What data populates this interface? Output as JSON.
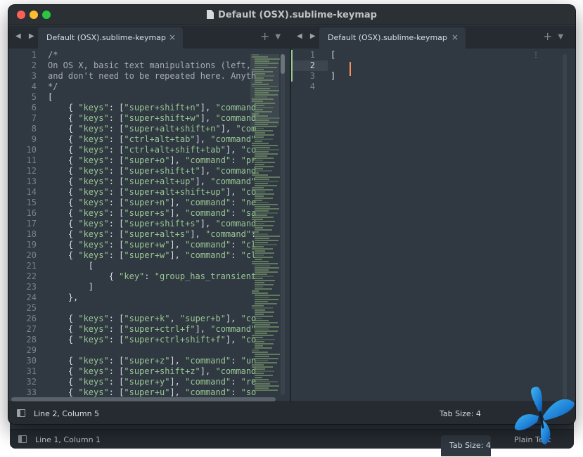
{
  "window": {
    "title": "Default (OSX).sublime-keymap"
  },
  "tabs": {
    "left_label": "Default (OSX).sublime-keymap",
    "right_label": "Default (OSX).sublime-keymap",
    "close_glyph": "×",
    "add_glyph": "+",
    "menu_glyph": "▼",
    "nav_glyph": "◀ ▶"
  },
  "left_pane": {
    "line_numbers": [
      "1",
      "2",
      "3",
      "4",
      "5",
      "6",
      "7",
      "8",
      "9",
      "10",
      "11",
      "12",
      "13",
      "14",
      "15",
      "16",
      "17",
      "18",
      "19",
      "20",
      "21",
      "22",
      "23",
      "24",
      "25",
      "26",
      "27",
      "28",
      "29",
      "30",
      "31",
      "32",
      "33"
    ],
    "lines": [
      [
        {
          "c": "c-com",
          "t": "/*"
        }
      ],
      [
        {
          "c": "c-com",
          "t": "On OS X, basic text manipulations (left,"
        }
      ],
      [
        {
          "c": "c-com",
          "t": "and don't need to be repeated here. Anyth"
        }
      ],
      [
        {
          "c": "c-com",
          "t": "*/"
        }
      ],
      [
        {
          "c": "c-txt",
          "t": "["
        }
      ],
      [
        {
          "c": "c-txt",
          "t": "    { "
        },
        {
          "c": "c-str",
          "t": "\"keys\""
        },
        {
          "c": "c-txt",
          "t": ": ["
        },
        {
          "c": "c-str",
          "t": "\"super+shift+n\""
        },
        {
          "c": "c-txt",
          "t": "], "
        },
        {
          "c": "c-str",
          "t": "\"command"
        }
      ],
      [
        {
          "c": "c-txt",
          "t": "    { "
        },
        {
          "c": "c-str",
          "t": "\"keys\""
        },
        {
          "c": "c-txt",
          "t": ": ["
        },
        {
          "c": "c-str",
          "t": "\"super+shift+w\""
        },
        {
          "c": "c-txt",
          "t": "], "
        },
        {
          "c": "c-str",
          "t": "\"command"
        }
      ],
      [
        {
          "c": "c-txt",
          "t": "    { "
        },
        {
          "c": "c-str",
          "t": "\"keys\""
        },
        {
          "c": "c-txt",
          "t": ": ["
        },
        {
          "c": "c-str",
          "t": "\"super+alt+shift+n\""
        },
        {
          "c": "c-txt",
          "t": "], "
        },
        {
          "c": "c-str",
          "t": "\"com"
        }
      ],
      [
        {
          "c": "c-txt",
          "t": "    { "
        },
        {
          "c": "c-str",
          "t": "\"keys\""
        },
        {
          "c": "c-txt",
          "t": ": ["
        },
        {
          "c": "c-str",
          "t": "\"ctrl+alt+tab\""
        },
        {
          "c": "c-txt",
          "t": "], "
        },
        {
          "c": "c-str",
          "t": "\"command\""
        }
      ],
      [
        {
          "c": "c-txt",
          "t": "    { "
        },
        {
          "c": "c-str",
          "t": "\"keys\""
        },
        {
          "c": "c-txt",
          "t": ": ["
        },
        {
          "c": "c-str",
          "t": "\"ctrl+alt+shift+tab\""
        },
        {
          "c": "c-txt",
          "t": "], "
        },
        {
          "c": "c-str",
          "t": "\"co"
        }
      ],
      [
        {
          "c": "c-txt",
          "t": "    { "
        },
        {
          "c": "c-str",
          "t": "\"keys\""
        },
        {
          "c": "c-txt",
          "t": ": ["
        },
        {
          "c": "c-str",
          "t": "\"super+o\""
        },
        {
          "c": "c-txt",
          "t": "], "
        },
        {
          "c": "c-str",
          "t": "\"command\""
        },
        {
          "c": "c-txt",
          "t": ": "
        },
        {
          "c": "c-str",
          "t": "\"pr"
        }
      ],
      [
        {
          "c": "c-txt",
          "t": "    { "
        },
        {
          "c": "c-str",
          "t": "\"keys\""
        },
        {
          "c": "c-txt",
          "t": ": ["
        },
        {
          "c": "c-str",
          "t": "\"super+shift+t\""
        },
        {
          "c": "c-txt",
          "t": "], "
        },
        {
          "c": "c-str",
          "t": "\"command"
        }
      ],
      [
        {
          "c": "c-txt",
          "t": "    { "
        },
        {
          "c": "c-str",
          "t": "\"keys\""
        },
        {
          "c": "c-txt",
          "t": ": ["
        },
        {
          "c": "c-str",
          "t": "\"super+alt+up\""
        },
        {
          "c": "c-txt",
          "t": "], "
        },
        {
          "c": "c-str",
          "t": "\"command\""
        }
      ],
      [
        {
          "c": "c-txt",
          "t": "    { "
        },
        {
          "c": "c-str",
          "t": "\"keys\""
        },
        {
          "c": "c-txt",
          "t": ": ["
        },
        {
          "c": "c-str",
          "t": "\"super+alt+shift+up\""
        },
        {
          "c": "c-txt",
          "t": "], "
        },
        {
          "c": "c-str",
          "t": "\"co"
        }
      ],
      [
        {
          "c": "c-txt",
          "t": "    { "
        },
        {
          "c": "c-str",
          "t": "\"keys\""
        },
        {
          "c": "c-txt",
          "t": ": ["
        },
        {
          "c": "c-str",
          "t": "\"super+n\""
        },
        {
          "c": "c-txt",
          "t": "], "
        },
        {
          "c": "c-str",
          "t": "\"command\""
        },
        {
          "c": "c-txt",
          "t": ": "
        },
        {
          "c": "c-str",
          "t": "\"ne"
        }
      ],
      [
        {
          "c": "c-txt",
          "t": "    { "
        },
        {
          "c": "c-str",
          "t": "\"keys\""
        },
        {
          "c": "c-txt",
          "t": ": ["
        },
        {
          "c": "c-str",
          "t": "\"super+s\""
        },
        {
          "c": "c-txt",
          "t": "], "
        },
        {
          "c": "c-str",
          "t": "\"command\""
        },
        {
          "c": "c-txt",
          "t": ": "
        },
        {
          "c": "c-str",
          "t": "\"sa"
        }
      ],
      [
        {
          "c": "c-txt",
          "t": "    { "
        },
        {
          "c": "c-str",
          "t": "\"keys\""
        },
        {
          "c": "c-txt",
          "t": ": ["
        },
        {
          "c": "c-str",
          "t": "\"super+shift+s\""
        },
        {
          "c": "c-txt",
          "t": "], "
        },
        {
          "c": "c-str",
          "t": "\"command"
        }
      ],
      [
        {
          "c": "c-txt",
          "t": "    { "
        },
        {
          "c": "c-str",
          "t": "\"keys\""
        },
        {
          "c": "c-txt",
          "t": ": ["
        },
        {
          "c": "c-str",
          "t": "\"super+alt+s\""
        },
        {
          "c": "c-txt",
          "t": "], "
        },
        {
          "c": "c-str",
          "t": "\"command\""
        },
        {
          "c": "c-txt",
          "t": ":"
        }
      ],
      [
        {
          "c": "c-txt",
          "t": "    { "
        },
        {
          "c": "c-str",
          "t": "\"keys\""
        },
        {
          "c": "c-txt",
          "t": ": ["
        },
        {
          "c": "c-str",
          "t": "\"super+w\""
        },
        {
          "c": "c-txt",
          "t": "], "
        },
        {
          "c": "c-str",
          "t": "\"command\""
        },
        {
          "c": "c-txt",
          "t": ": "
        },
        {
          "c": "c-str",
          "t": "\"cl"
        }
      ],
      [
        {
          "c": "c-txt",
          "t": "    { "
        },
        {
          "c": "c-str",
          "t": "\"keys\""
        },
        {
          "c": "c-txt",
          "t": ": ["
        },
        {
          "c": "c-str",
          "t": "\"super+w\""
        },
        {
          "c": "c-txt",
          "t": "], "
        },
        {
          "c": "c-str",
          "t": "\"command\""
        },
        {
          "c": "c-txt",
          "t": ": "
        },
        {
          "c": "c-str",
          "t": "\"cl"
        }
      ],
      [
        {
          "c": "c-txt",
          "t": "        ["
        }
      ],
      [
        {
          "c": "c-txt",
          "t": "            { "
        },
        {
          "c": "c-str",
          "t": "\"key\""
        },
        {
          "c": "c-txt",
          "t": ": "
        },
        {
          "c": "c-str",
          "t": "\"group_has_transient"
        }
      ],
      [
        {
          "c": "c-txt",
          "t": "        ]"
        }
      ],
      [
        {
          "c": "c-txt",
          "t": "    },"
        }
      ],
      [
        {
          "c": "c-txt",
          "t": ""
        }
      ],
      [
        {
          "c": "c-txt",
          "t": "    { "
        },
        {
          "c": "c-str",
          "t": "\"keys\""
        },
        {
          "c": "c-txt",
          "t": ": ["
        },
        {
          "c": "c-str",
          "t": "\"super+k\""
        },
        {
          "c": "c-txt",
          "t": ", "
        },
        {
          "c": "c-str",
          "t": "\"super+b\""
        },
        {
          "c": "c-txt",
          "t": "], "
        },
        {
          "c": "c-str",
          "t": "\"co"
        }
      ],
      [
        {
          "c": "c-txt",
          "t": "    { "
        },
        {
          "c": "c-str",
          "t": "\"keys\""
        },
        {
          "c": "c-txt",
          "t": ": ["
        },
        {
          "c": "c-str",
          "t": "\"super+ctrl+f\""
        },
        {
          "c": "c-txt",
          "t": "], "
        },
        {
          "c": "c-str",
          "t": "\"command\""
        }
      ],
      [
        {
          "c": "c-txt",
          "t": "    { "
        },
        {
          "c": "c-str",
          "t": "\"keys\""
        },
        {
          "c": "c-txt",
          "t": ": ["
        },
        {
          "c": "c-str",
          "t": "\"super+ctrl+shift+f\""
        },
        {
          "c": "c-txt",
          "t": "], "
        },
        {
          "c": "c-str",
          "t": "\"co"
        }
      ],
      [
        {
          "c": "c-txt",
          "t": ""
        }
      ],
      [
        {
          "c": "c-txt",
          "t": "    { "
        },
        {
          "c": "c-str",
          "t": "\"keys\""
        },
        {
          "c": "c-txt",
          "t": ": ["
        },
        {
          "c": "c-str",
          "t": "\"super+z\""
        },
        {
          "c": "c-txt",
          "t": "], "
        },
        {
          "c": "c-str",
          "t": "\"command\""
        },
        {
          "c": "c-txt",
          "t": ": "
        },
        {
          "c": "c-str",
          "t": "\"un"
        }
      ],
      [
        {
          "c": "c-txt",
          "t": "    { "
        },
        {
          "c": "c-str",
          "t": "\"keys\""
        },
        {
          "c": "c-txt",
          "t": ": ["
        },
        {
          "c": "c-str",
          "t": "\"super+shift+z\""
        },
        {
          "c": "c-txt",
          "t": "], "
        },
        {
          "c": "c-str",
          "t": "\"command"
        }
      ],
      [
        {
          "c": "c-txt",
          "t": "    { "
        },
        {
          "c": "c-str",
          "t": "\"keys\""
        },
        {
          "c": "c-txt",
          "t": ": ["
        },
        {
          "c": "c-str",
          "t": "\"super+y\""
        },
        {
          "c": "c-txt",
          "t": "], "
        },
        {
          "c": "c-str",
          "t": "\"command\""
        },
        {
          "c": "c-txt",
          "t": ": "
        },
        {
          "c": "c-str",
          "t": "\"re"
        }
      ],
      [
        {
          "c": "c-txt",
          "t": "    { "
        },
        {
          "c": "c-str",
          "t": "\"keys\""
        },
        {
          "c": "c-txt",
          "t": ": ["
        },
        {
          "c": "c-str",
          "t": "\"super+u\""
        },
        {
          "c": "c-txt",
          "t": "], "
        },
        {
          "c": "c-str",
          "t": "\"command\""
        },
        {
          "c": "c-txt",
          "t": ": "
        },
        {
          "c": "c-str",
          "t": "\"so"
        }
      ]
    ]
  },
  "right_pane": {
    "line_numbers": [
      "1",
      "2",
      "3",
      "4"
    ],
    "active_line": "2",
    "lines": [
      "[",
      "",
      "]",
      ""
    ],
    "dots": "⋮"
  },
  "status": {
    "position": "Line 2, Column 5",
    "tab_size": "Tab Size: 4"
  },
  "background_window": {
    "position": "Line 1, Column 1",
    "tab_size": "Tab Size: 4",
    "syntax": "Plain Text"
  },
  "colors": {
    "editor_bg": "#303841",
    "string": "#99c794",
    "comment": "#a6acb9",
    "cursor": "#f99157"
  }
}
